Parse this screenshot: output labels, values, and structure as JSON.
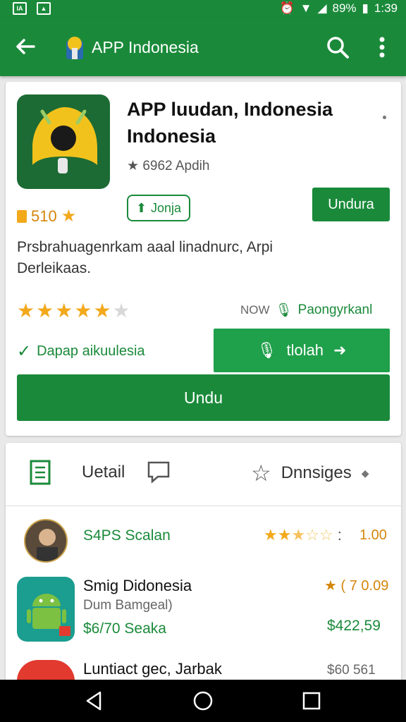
{
  "status_bar": {
    "battery": "89%",
    "time": "1:39"
  },
  "app_bar": {
    "title": "APP Indonesia"
  },
  "app": {
    "title": "APP luudan, Indonesia Indonesia",
    "meta": "6962 Apdih",
    "rating_count": "510",
    "chip_label": "Jonja",
    "install_small_label": "Undura",
    "description": "Prsbrahuagenrkam aaal linadnurc, Arpi Derleikaas.",
    "stars_value": 4.5,
    "now_prefix": "NOW",
    "now_label": "Paongyrkanl",
    "check_label": "Dapap aikuulesia",
    "install_button_label": "tlolah",
    "big_button_label": "Undu"
  },
  "tabs": [
    {
      "label": "Uetail"
    },
    {
      "label": ""
    },
    {
      "label": "Dnnsiges"
    }
  ],
  "list": [
    {
      "title": "S4PS Scalan",
      "rating_value": "1.00",
      "stars_value": 2.5
    },
    {
      "title": "Smig Didonesia",
      "subtitle": "Dum Bamgeal)",
      "price_line": "$6/70 Seaka",
      "rating": "( 7 0.09",
      "price_right": "$422,59"
    },
    {
      "title": "Luntiact gec, Jarbak",
      "price_right": "$60 561"
    }
  ],
  "colors": {
    "primary": "#1a8a3a",
    "accent_star": "#f2a91c"
  }
}
